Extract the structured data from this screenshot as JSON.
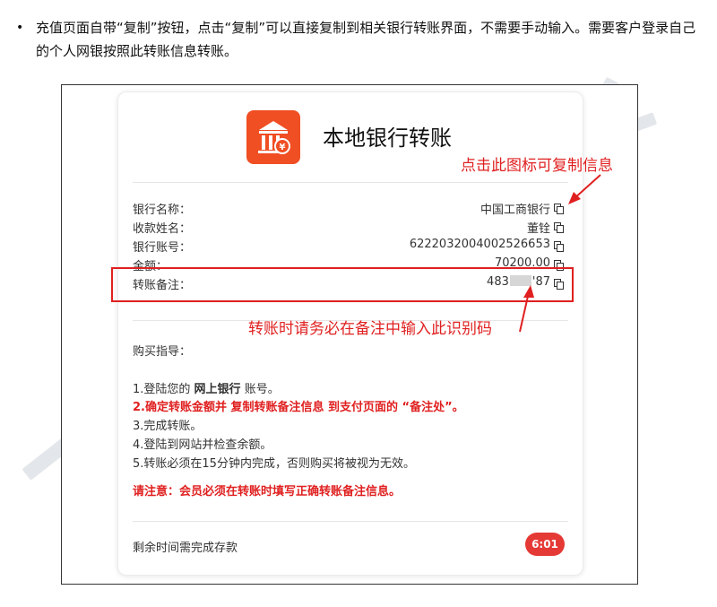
{
  "intro": {
    "bullet": "•",
    "text": "充值页面自带“复制”按钮，点击“复制”可以直接复制到相关银行转账界面，不需要手动输入。需要客户登录自己的个人网银按照此转账信息转账。"
  },
  "card": {
    "title": "本地银行转账",
    "info": [
      {
        "label": "银行名称：",
        "value": "中国工商银行"
      },
      {
        "label": "收款姓名：",
        "value": "董铨"
      },
      {
        "label": "银行账号：",
        "value": "6222032004002526653"
      },
      {
        "label": "金额：",
        "value": "70200.00"
      },
      {
        "label": "转账备注：",
        "value_prefix": "483",
        "value_suffix": "'87"
      }
    ],
    "guide_title": "购买指导：",
    "steps": {
      "s1_pre": "1.登陆您的",
      "s1_bold": "网上银行",
      "s1_post": "账号。",
      "s2": "2.确定转账金额并 复制转账备注信息 到支付页面的 “备注处”。",
      "s3": "3.完成转账。",
      "s4": "4.登陆到网站并检查余额。",
      "s5": "5.转账必须在15分钟内完成，否则购买将被视为无效。"
    },
    "notice": "请注意：会员必须在转账时填写正确转账备注信息。",
    "remaining_label": "剩余时间需完成存款",
    "timer": "6:01"
  },
  "annotations": {
    "copy_tip": "点击此图标可复制信息",
    "remark_tip": "转账时请务必在备注中输入此识别码"
  },
  "colors": {
    "accent_red": "#e02020",
    "bank_logo_bg": "#f04e23",
    "timer_bg": "#e53935"
  }
}
